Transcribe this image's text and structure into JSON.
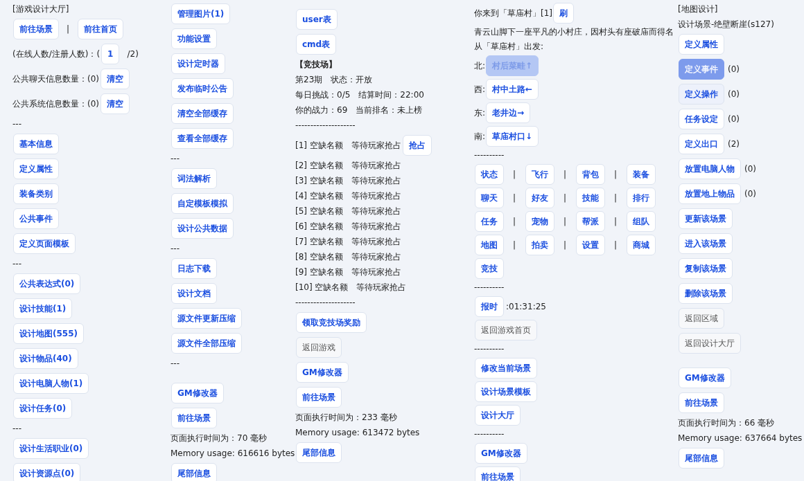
{
  "columns": [
    {
      "lines": [
        {
          "kind": "row",
          "items": [
            {
              "kind": "text",
              "text": "[游戏设计大厅]"
            }
          ]
        },
        {
          "kind": "row",
          "items": [
            {
              "kind": "link",
              "label": "前往场景"
            },
            {
              "kind": "text",
              "text": "|"
            },
            {
              "kind": "link",
              "label": "前往首页"
            }
          ]
        },
        {
          "kind": "row",
          "items": [
            {
              "kind": "text",
              "text": "(在线人数/注册人数)：("
            },
            {
              "kind": "link",
              "label": "1"
            },
            {
              "kind": "text",
              "text": "/2)"
            }
          ]
        },
        {
          "kind": "row",
          "items": [
            {
              "kind": "text",
              "text": "公共聊天信息数量：(0)"
            },
            {
              "kind": "link",
              "label": "清空"
            }
          ]
        },
        {
          "kind": "row",
          "items": [
            {
              "kind": "text",
              "text": "公共系统信息数量：(0)"
            },
            {
              "kind": "link",
              "label": "清空"
            }
          ]
        },
        {
          "kind": "row",
          "items": [
            {
              "kind": "text",
              "text": "---"
            }
          ]
        },
        {
          "kind": "row",
          "items": [
            {
              "kind": "link",
              "label": "基本信息"
            }
          ]
        },
        {
          "kind": "row",
          "items": [
            {
              "kind": "link",
              "label": "定义属性"
            }
          ]
        },
        {
          "kind": "row",
          "items": [
            {
              "kind": "link",
              "label": "装备类别"
            }
          ]
        },
        {
          "kind": "row",
          "items": [
            {
              "kind": "link",
              "label": "公共事件"
            }
          ]
        },
        {
          "kind": "row",
          "items": [
            {
              "kind": "link",
              "label": "定义页面模板"
            }
          ]
        },
        {
          "kind": "row",
          "items": [
            {
              "kind": "text",
              "text": "---"
            }
          ]
        },
        {
          "kind": "row",
          "items": [
            {
              "kind": "link",
              "label": "公共表达式(0)"
            }
          ]
        },
        {
          "kind": "row",
          "items": [
            {
              "kind": "link",
              "label": "设计技能(1)"
            }
          ]
        },
        {
          "kind": "row",
          "items": [
            {
              "kind": "link",
              "label": "设计地图(555)"
            }
          ]
        },
        {
          "kind": "row",
          "items": [
            {
              "kind": "link",
              "label": "设计物品(40)"
            }
          ]
        },
        {
          "kind": "row",
          "items": [
            {
              "kind": "link",
              "label": "设计电脑人物(1)"
            }
          ]
        },
        {
          "kind": "row",
          "items": [
            {
              "kind": "link",
              "label": "设计任务(0)"
            }
          ]
        },
        {
          "kind": "row",
          "items": [
            {
              "kind": "text",
              "text": "---"
            }
          ]
        },
        {
          "kind": "row",
          "items": [
            {
              "kind": "link",
              "label": "设计生活职业(0)"
            }
          ]
        },
        {
          "kind": "row",
          "items": [
            {
              "kind": "link",
              "label": "设计资源点(0)"
            }
          ]
        }
      ]
    },
    {
      "lines": [
        {
          "kind": "row",
          "items": [
            {
              "kind": "link",
              "label": "管理图片(1)"
            }
          ]
        },
        {
          "kind": "row",
          "items": [
            {
              "kind": "link",
              "label": "功能设置"
            }
          ]
        },
        {
          "kind": "row",
          "items": [
            {
              "kind": "link",
              "label": "设计定时器"
            }
          ]
        },
        {
          "kind": "row",
          "items": [
            {
              "kind": "link",
              "label": "发布临时公告"
            }
          ]
        },
        {
          "kind": "row",
          "items": [
            {
              "kind": "link",
              "label": "清空全部缓存"
            }
          ]
        },
        {
          "kind": "row",
          "items": [
            {
              "kind": "link",
              "label": "查看全部缓存"
            }
          ]
        },
        {
          "kind": "row",
          "items": [
            {
              "kind": "text",
              "text": "---"
            }
          ]
        },
        {
          "kind": "row",
          "items": [
            {
              "kind": "link",
              "label": "词法解析"
            }
          ]
        },
        {
          "kind": "row",
          "items": [
            {
              "kind": "link",
              "label": "自定模板模拟"
            }
          ]
        },
        {
          "kind": "row",
          "items": [
            {
              "kind": "link",
              "label": "设计公共数据"
            }
          ]
        },
        {
          "kind": "row",
          "items": [
            {
              "kind": "text",
              "text": "---"
            }
          ]
        },
        {
          "kind": "row",
          "items": [
            {
              "kind": "link",
              "label": "日志下载"
            }
          ]
        },
        {
          "kind": "row",
          "items": [
            {
              "kind": "link",
              "label": "设计文档"
            }
          ]
        },
        {
          "kind": "row",
          "items": [
            {
              "kind": "link",
              "label": "源文件更新压缩"
            }
          ]
        },
        {
          "kind": "row",
          "items": [
            {
              "kind": "link",
              "label": "源文件全部压缩"
            }
          ]
        },
        {
          "kind": "row",
          "items": [
            {
              "kind": "text",
              "text": "---"
            }
          ]
        },
        {
          "kind": "spacer"
        },
        {
          "kind": "row",
          "items": [
            {
              "kind": "link",
              "label": "GM修改器"
            }
          ]
        },
        {
          "kind": "row",
          "items": [
            {
              "kind": "link",
              "label": "前往场景"
            }
          ]
        },
        {
          "kind": "row",
          "items": [
            {
              "kind": "text",
              "text": "页面执行时间为：70 毫秒"
            }
          ]
        },
        {
          "kind": "row",
          "items": [
            {
              "kind": "text",
              "text": "Memory usage: 616616 bytes"
            }
          ]
        },
        {
          "kind": "row",
          "items": [
            {
              "kind": "link",
              "label": "尾部信息"
            }
          ]
        }
      ]
    },
    {
      "lines": [
        {
          "kind": "spacer"
        },
        {
          "kind": "row",
          "items": [
            {
              "kind": "link",
              "label": "user表"
            }
          ]
        },
        {
          "kind": "row",
          "items": [
            {
              "kind": "link",
              "label": "cmd表"
            }
          ]
        },
        {
          "kind": "row",
          "items": [
            {
              "kind": "heading",
              "text": "【竞技场】"
            }
          ]
        },
        {
          "kind": "row",
          "items": [
            {
              "kind": "text",
              "text": "第23期　状态：开放"
            }
          ]
        },
        {
          "kind": "row",
          "items": [
            {
              "kind": "text",
              "text": "每日挑战：0/5　结算时间：22:00"
            }
          ]
        },
        {
          "kind": "row",
          "items": [
            {
              "kind": "text",
              "text": "你的战力：69　当前排名：未上榜"
            }
          ]
        },
        {
          "kind": "row",
          "items": [
            {
              "kind": "text",
              "text": "--------------------"
            }
          ]
        },
        {
          "kind": "row",
          "items": [
            {
              "kind": "text",
              "text": "[1] 空缺名额　等待玩家抢占"
            },
            {
              "kind": "link",
              "label": "抢占"
            }
          ]
        },
        {
          "kind": "row",
          "items": [
            {
              "kind": "text",
              "text": "[2] 空缺名额　等待玩家抢占"
            }
          ]
        },
        {
          "kind": "row",
          "items": [
            {
              "kind": "text",
              "text": "[3] 空缺名额　等待玩家抢占"
            }
          ]
        },
        {
          "kind": "row",
          "items": [
            {
              "kind": "text",
              "text": "[4] 空缺名额　等待玩家抢占"
            }
          ]
        },
        {
          "kind": "row",
          "items": [
            {
              "kind": "text",
              "text": "[5] 空缺名额　等待玩家抢占"
            }
          ]
        },
        {
          "kind": "row",
          "items": [
            {
              "kind": "text",
              "text": "[6] 空缺名额　等待玩家抢占"
            }
          ]
        },
        {
          "kind": "row",
          "items": [
            {
              "kind": "text",
              "text": "[7] 空缺名额　等待玩家抢占"
            }
          ]
        },
        {
          "kind": "row",
          "items": [
            {
              "kind": "text",
              "text": "[8] 空缺名额　等待玩家抢占"
            }
          ]
        },
        {
          "kind": "row",
          "items": [
            {
              "kind": "text",
              "text": "[9] 空缺名额　等待玩家抢占"
            }
          ]
        },
        {
          "kind": "row",
          "items": [
            {
              "kind": "text",
              "text": "[10] 空缺名额　等待玩家抢占"
            }
          ]
        },
        {
          "kind": "row",
          "items": [
            {
              "kind": "text",
              "text": "--------------------"
            }
          ]
        },
        {
          "kind": "row",
          "items": [
            {
              "kind": "link",
              "label": "领取竞技场奖励"
            }
          ]
        },
        {
          "kind": "row",
          "items": [
            {
              "kind": "button",
              "label": "返回游戏"
            }
          ]
        },
        {
          "kind": "row",
          "items": [
            {
              "kind": "link",
              "label": "GM修改器"
            }
          ]
        },
        {
          "kind": "row",
          "items": [
            {
              "kind": "link",
              "label": "前往场景"
            }
          ]
        },
        {
          "kind": "row",
          "items": [
            {
              "kind": "text",
              "text": "页面执行时间为：233 毫秒"
            }
          ]
        },
        {
          "kind": "row",
          "items": [
            {
              "kind": "text",
              "text": "Memory usage: 613472 bytes"
            }
          ]
        },
        {
          "kind": "row",
          "items": [
            {
              "kind": "link",
              "label": "尾部信息"
            }
          ]
        }
      ]
    },
    {
      "lines": [
        {
          "kind": "row",
          "items": [
            {
              "kind": "text",
              "text": "你来到「草庙村」[1]"
            },
            {
              "kind": "link",
              "label": "刷"
            }
          ]
        },
        {
          "kind": "row",
          "items": [
            {
              "kind": "text",
              "text": "青云山脚下一座平凡的小村庄，因村头有座破庙而得名"
            }
          ]
        },
        {
          "kind": "row",
          "items": [
            {
              "kind": "text",
              "text": "从「草庙村」出发:"
            }
          ]
        },
        {
          "kind": "row",
          "items": [
            {
              "kind": "text",
              "text": "北:"
            },
            {
              "kind": "link",
              "label": "村后菜畦↑",
              "hovered": true
            }
          ]
        },
        {
          "kind": "row",
          "items": [
            {
              "kind": "text",
              "text": "西:"
            },
            {
              "kind": "link",
              "label": "村中土路←"
            }
          ]
        },
        {
          "kind": "row",
          "items": [
            {
              "kind": "text",
              "text": "东:"
            },
            {
              "kind": "link",
              "label": "老井边→"
            }
          ]
        },
        {
          "kind": "row",
          "items": [
            {
              "kind": "text",
              "text": "南:"
            },
            {
              "kind": "link",
              "label": "草庙村口↓"
            }
          ]
        },
        {
          "kind": "row",
          "items": [
            {
              "kind": "text",
              "text": "----------"
            }
          ]
        },
        {
          "kind": "row",
          "items": [
            {
              "kind": "link",
              "label": "状态"
            },
            {
              "kind": "text",
              "text": "|"
            },
            {
              "kind": "link",
              "label": "飞行"
            },
            {
              "kind": "text",
              "text": "|"
            },
            {
              "kind": "link",
              "label": "背包"
            },
            {
              "kind": "text",
              "text": "|"
            },
            {
              "kind": "link",
              "label": "装备"
            }
          ]
        },
        {
          "kind": "row",
          "items": [
            {
              "kind": "link",
              "label": "聊天"
            },
            {
              "kind": "text",
              "text": "|"
            },
            {
              "kind": "link",
              "label": "好友"
            },
            {
              "kind": "text",
              "text": "|"
            },
            {
              "kind": "link",
              "label": "技能"
            },
            {
              "kind": "text",
              "text": "|"
            },
            {
              "kind": "link",
              "label": "排行"
            }
          ]
        },
        {
          "kind": "row",
          "items": [
            {
              "kind": "link",
              "label": "任务"
            },
            {
              "kind": "text",
              "text": "|"
            },
            {
              "kind": "link",
              "label": "宠物"
            },
            {
              "kind": "text",
              "text": "|"
            },
            {
              "kind": "link",
              "label": "帮派"
            },
            {
              "kind": "text",
              "text": "|"
            },
            {
              "kind": "link",
              "label": "组队"
            }
          ]
        },
        {
          "kind": "row",
          "items": [
            {
              "kind": "link",
              "label": "地图"
            },
            {
              "kind": "text",
              "text": "|"
            },
            {
              "kind": "link",
              "label": "拍卖"
            },
            {
              "kind": "text",
              "text": "|"
            },
            {
              "kind": "link",
              "label": "设置"
            },
            {
              "kind": "text",
              "text": "|"
            },
            {
              "kind": "link",
              "label": "商城"
            }
          ]
        },
        {
          "kind": "row",
          "items": [
            {
              "kind": "link",
              "label": "竞技"
            }
          ]
        },
        {
          "kind": "row",
          "items": [
            {
              "kind": "text",
              "text": "----------"
            }
          ]
        },
        {
          "kind": "row",
          "items": [
            {
              "kind": "link",
              "label": "报时"
            },
            {
              "kind": "text",
              "text": ":01:31:25"
            }
          ]
        },
        {
          "kind": "row",
          "items": [
            {
              "kind": "button",
              "label": "返回游戏首页"
            }
          ]
        },
        {
          "kind": "row",
          "items": [
            {
              "kind": "text",
              "text": "----------"
            }
          ]
        },
        {
          "kind": "row",
          "items": [
            {
              "kind": "link",
              "label": "修改当前场景"
            }
          ]
        },
        {
          "kind": "row",
          "items": [
            {
              "kind": "link",
              "label": "设计场景模板"
            }
          ]
        },
        {
          "kind": "row",
          "items": [
            {
              "kind": "link",
              "label": "设计大厅"
            }
          ]
        },
        {
          "kind": "row",
          "items": [
            {
              "kind": "text",
              "text": "----------"
            }
          ]
        },
        {
          "kind": "row",
          "items": [
            {
              "kind": "link",
              "label": "GM修改器"
            }
          ]
        },
        {
          "kind": "row",
          "items": [
            {
              "kind": "link",
              "label": "前往场景"
            }
          ]
        }
      ]
    },
    {
      "lines": [
        {
          "kind": "row",
          "items": [
            {
              "kind": "text",
              "text": "[地图设计]"
            }
          ]
        },
        {
          "kind": "row",
          "items": [
            {
              "kind": "text",
              "text": "设计场景-绝壁断崖(s127)"
            }
          ]
        },
        {
          "kind": "row",
          "items": [
            {
              "kind": "link",
              "label": "定义属性"
            }
          ]
        },
        {
          "kind": "row",
          "items": [
            {
              "kind": "link",
              "label": "定义事件",
              "pressed": true
            },
            {
              "kind": "text",
              "text": "(0)"
            }
          ]
        },
        {
          "kind": "row",
          "items": [
            {
              "kind": "link",
              "label": "定义操作",
              "focused": true
            },
            {
              "kind": "text",
              "text": "(0)"
            }
          ]
        },
        {
          "kind": "row",
          "items": [
            {
              "kind": "link",
              "label": "任务设定"
            },
            {
              "kind": "text",
              "text": "(0)"
            }
          ]
        },
        {
          "kind": "row",
          "items": [
            {
              "kind": "link",
              "label": "定义出口"
            },
            {
              "kind": "text",
              "text": "(2)"
            }
          ]
        },
        {
          "kind": "row",
          "items": [
            {
              "kind": "link",
              "label": "放置电脑人物"
            },
            {
              "kind": "text",
              "text": "(0)"
            }
          ]
        },
        {
          "kind": "row",
          "items": [
            {
              "kind": "link",
              "label": "放置地上物品"
            },
            {
              "kind": "text",
              "text": "(0)"
            }
          ]
        },
        {
          "kind": "row",
          "items": [
            {
              "kind": "link",
              "label": "更新该场景"
            }
          ]
        },
        {
          "kind": "row",
          "items": [
            {
              "kind": "link",
              "label": "进入该场景"
            }
          ]
        },
        {
          "kind": "row",
          "items": [
            {
              "kind": "link",
              "label": "复制该场景"
            }
          ]
        },
        {
          "kind": "row",
          "items": [
            {
              "kind": "link",
              "label": "删除该场景"
            }
          ]
        },
        {
          "kind": "row",
          "items": [
            {
              "kind": "button",
              "label": "返回区域"
            }
          ]
        },
        {
          "kind": "row",
          "items": [
            {
              "kind": "button",
              "label": "返回设计大厅"
            }
          ]
        },
        {
          "kind": "spacer"
        },
        {
          "kind": "row",
          "items": [
            {
              "kind": "link",
              "label": "GM修改器"
            }
          ]
        },
        {
          "kind": "row",
          "items": [
            {
              "kind": "link",
              "label": "前往场景"
            }
          ]
        },
        {
          "kind": "row",
          "items": [
            {
              "kind": "text",
              "text": "页面执行时间为：66 毫秒"
            }
          ]
        },
        {
          "kind": "row",
          "items": [
            {
              "kind": "text",
              "text": "Memory usage: 637664 bytes"
            }
          ]
        },
        {
          "kind": "row",
          "items": [
            {
              "kind": "link",
              "label": "尾部信息"
            }
          ]
        }
      ]
    }
  ]
}
